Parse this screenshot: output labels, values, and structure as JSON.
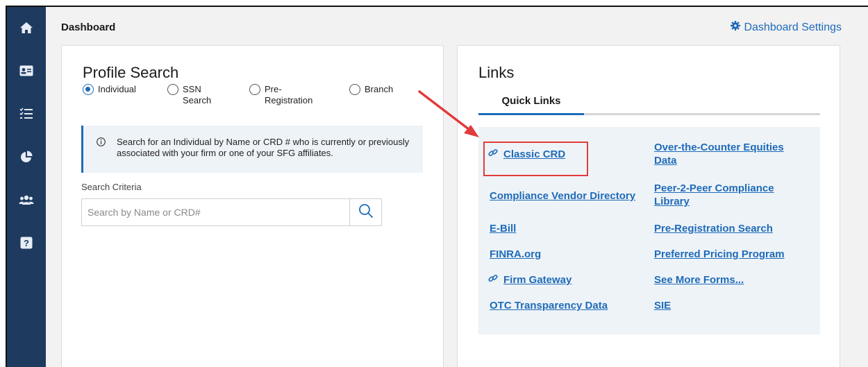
{
  "sidebar": {
    "items": [
      {
        "icon": "home-icon"
      },
      {
        "icon": "id-card-icon"
      },
      {
        "icon": "checklist-icon"
      },
      {
        "icon": "pie-chart-icon"
      },
      {
        "icon": "users-icon"
      },
      {
        "icon": "help-icon"
      }
    ]
  },
  "header": {
    "title": "Dashboard",
    "settings_label": "Dashboard Settings"
  },
  "profile_search": {
    "title": "Profile Search",
    "radios": [
      {
        "line1": "Individual",
        "line2": "",
        "selected": true
      },
      {
        "line1": "SSN",
        "line2": "Search",
        "selected": false
      },
      {
        "line1": "Pre-",
        "line2": "Registration",
        "selected": false
      },
      {
        "line1": "Branch",
        "line2": "",
        "selected": false
      }
    ],
    "info_text": "Search for an Individual by Name or CRD # who is currently or previously associated with your firm or one of your SFG affiliates.",
    "criteria_label": "Search Criteria",
    "search_placeholder": "Search by Name or CRD#"
  },
  "links": {
    "title": "Links",
    "tab_label": "Quick Links",
    "left_column": [
      {
        "label": "Classic CRD",
        "chain_icon": true,
        "highlighted": true
      },
      {
        "label": "Compliance Vendor Directory",
        "chain_icon": false
      },
      {
        "label": "E-Bill",
        "chain_icon": false
      },
      {
        "label": "FINRA.org",
        "chain_icon": false
      },
      {
        "label": "Firm Gateway",
        "chain_icon": true
      },
      {
        "label": "OTC Transparency Data",
        "chain_icon": false
      }
    ],
    "right_column": [
      {
        "line1": "Over-the-Counter Equities",
        "line2": "Data"
      },
      {
        "line1": "Peer-2-Peer Compliance",
        "line2": "Library"
      },
      {
        "line1": "Pre-Registration Search",
        "line2": ""
      },
      {
        "line1": "Preferred Pricing Program",
        "line2": ""
      },
      {
        "line1": "See More Forms...",
        "line2": ""
      },
      {
        "line1": "SIE",
        "line2": ""
      }
    ]
  },
  "colors": {
    "sidebar": "#1f3a5f",
    "link": "#1e6bb8",
    "highlight": "#e23b3b"
  }
}
